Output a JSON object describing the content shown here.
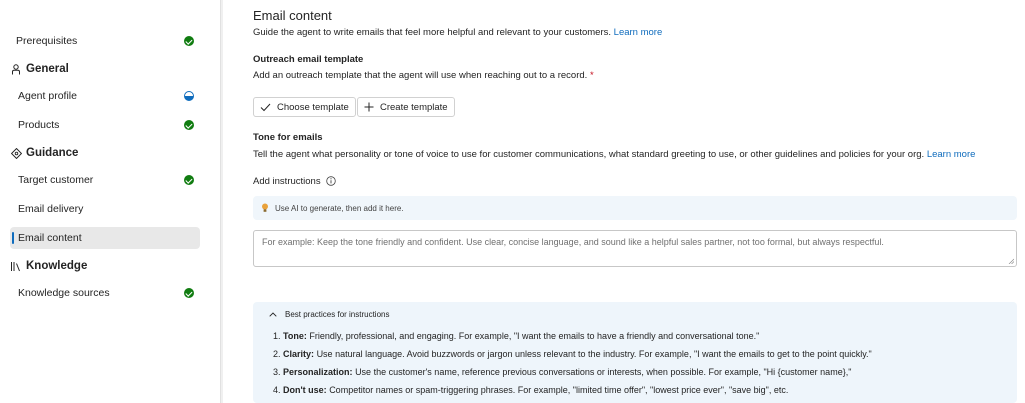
{
  "sidebar": {
    "items_top": [
      {
        "label": "Prerequisites",
        "status": "complete"
      }
    ],
    "sections": [
      {
        "title": "General",
        "icon": "person-icon",
        "items": [
          {
            "label": "Agent profile",
            "status": "in-progress"
          },
          {
            "label": "Products",
            "status": "complete"
          }
        ]
      },
      {
        "title": "Guidance",
        "icon": "compass-icon",
        "items": [
          {
            "label": "Target customer",
            "status": "complete"
          },
          {
            "label": "Email delivery",
            "status": "none"
          },
          {
            "label": "Email content",
            "status": "none",
            "active": true
          }
        ]
      },
      {
        "title": "Knowledge",
        "icon": "library-icon",
        "items": [
          {
            "label": "Knowledge sources",
            "status": "complete"
          }
        ]
      }
    ]
  },
  "main": {
    "title": "Email content",
    "description": "Guide the agent to write emails that feel more helpful and relevant to your customers.",
    "description_link": "Learn more",
    "template": {
      "heading": "Outreach email template",
      "description": "Add an outreach template that the agent will use when reaching out to a record.",
      "required_mark": "*",
      "choose_label": "Choose template",
      "create_label": "Create template"
    },
    "tone": {
      "heading": "Tone for emails",
      "description": "Tell the agent what personality or tone of voice to use for customer communications, what standard greeting to use, or other guidelines and policies for your org.",
      "link": "Learn more",
      "instructions_label": "Add instructions",
      "ai_hint": "Use AI to generate, then add it here.",
      "placeholder": "For example: Keep the tone friendly and confident. Use clear, concise language, and sound like a helpful sales partner, not too formal, but always respectful."
    },
    "best_practices": {
      "title": "Best practices for instructions",
      "items": [
        {
          "num": "1.",
          "term": "Tone:",
          "text": "Friendly, professional, and engaging. For example, \"I want the emails to have a friendly and conversational tone.\""
        },
        {
          "num": "2.",
          "term": "Clarity:",
          "text": "Use natural language. Avoid buzzwords or jargon unless relevant to the industry. For example, \"I want the emails to get to the point quickly.\""
        },
        {
          "num": "3.",
          "term": "Personalization:",
          "text": "Use the customer's name, reference previous conversations or interests, when possible. For example, \"Hi {customer name},\""
        },
        {
          "num": "4.",
          "term": "Don't use:",
          "text": "Competitor names or spam-triggering phrases. For example, \"limited time offer\", \"lowest price ever\", \"save big\", etc."
        }
      ]
    }
  },
  "colors": {
    "accent": "#0f6cbd",
    "success": "#107c10",
    "required": "#c50f1f",
    "ai_bar_bg": "#f0f6fb"
  }
}
